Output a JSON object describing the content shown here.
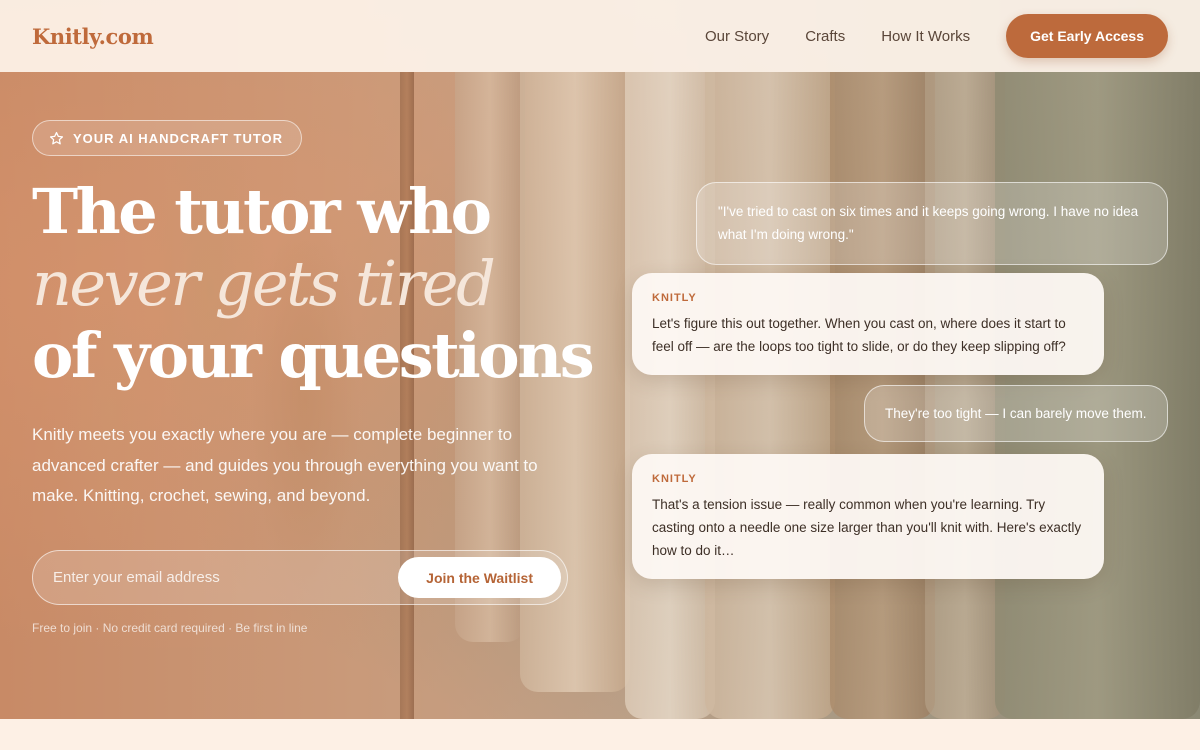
{
  "nav": {
    "logo": "Knitly.com",
    "links": [
      "Our Story",
      "Crafts",
      "How It Works"
    ],
    "cta": "Get Early Access"
  },
  "hero": {
    "badge": {
      "icon": "star-icon",
      "label": "YOUR AI HANDCRAFT TUTOR"
    },
    "headline": {
      "line1": "The tutor who",
      "line2": "never gets tired",
      "line3": "of your questions"
    },
    "subcopy": "Knitly meets you exactly where you are — complete beginner to advanced crafter — and guides you through everything you want to make. Knitting, crochet, sewing, and beyond.",
    "signup": {
      "placeholder": "Enter your email address",
      "button": "Join the Waitlist"
    },
    "fineprint": "Free to join · No credit card required · Be first in line"
  },
  "chat": {
    "messages": [
      {
        "from": "user",
        "text": "\"I've tried to cast on six times and it keeps going wrong. I have no idea what I'm doing wrong.\""
      },
      {
        "from": "bot",
        "sender": "KNITLY",
        "text": "Let's figure this out together. When you cast on, where does it start to feel off — are the loops too tight to slide, or do they keep slipping off?"
      },
      {
        "from": "user",
        "text": "They're too tight — I can barely move them."
      },
      {
        "from": "bot",
        "sender": "KNITLY",
        "text": "That's a tension issue — really common when you're learning. Try casting onto a needle one size larger than you'll knit with. Here's exactly how to do it…"
      }
    ]
  },
  "colors": {
    "brand": "#bf6a3b",
    "cta": "#bd6a3c",
    "nav_bg": "#fdf3ea",
    "bot_bubble": "#fdf8f3"
  }
}
